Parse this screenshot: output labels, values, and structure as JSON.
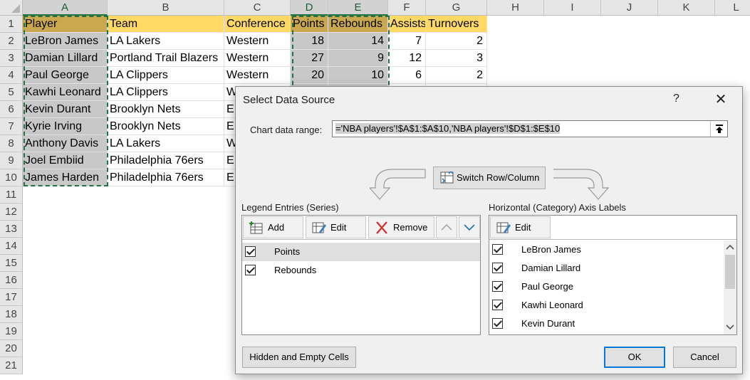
{
  "sheet": {
    "columns": [
      "A",
      "B",
      "C",
      "D",
      "E",
      "F",
      "G",
      "H",
      "I",
      "J",
      "K",
      "L"
    ],
    "rows": [
      "1",
      "2",
      "3",
      "4",
      "5",
      "6",
      "7",
      "8",
      "9",
      "10",
      "11",
      "12",
      "13",
      "14",
      "15",
      "16",
      "17",
      "18",
      "19",
      "20",
      "21"
    ],
    "header": [
      "Player",
      "Team",
      "Conference",
      "Points",
      "Rebounds",
      "Assists",
      "Turnovers"
    ],
    "data": [
      [
        "LeBron James",
        "LA Lakers",
        "Western",
        "18",
        "14",
        "7",
        "2"
      ],
      [
        "Damian Lillard",
        "Portland Trail Blazers",
        "Western",
        "27",
        "9",
        "12",
        "3"
      ],
      [
        "Paul George",
        "LA Clippers",
        "Western",
        "20",
        "10",
        "6",
        "2"
      ],
      [
        "Kawhi Leonard",
        "LA Clippers",
        "W",
        "",
        "",
        "",
        ""
      ],
      [
        "Kevin Durant",
        "Brooklyn Nets",
        "E",
        "",
        "",
        "",
        ""
      ],
      [
        "Kyrie Irving",
        "Brooklyn Nets",
        "E",
        "",
        "",
        "",
        ""
      ],
      [
        "Anthony Davis",
        "LA Lakers",
        "W",
        "",
        "",
        "",
        ""
      ],
      [
        "Joel Embiid",
        "Philadelphia 76ers",
        "E",
        "",
        "",
        "",
        ""
      ],
      [
        "James Harden",
        "Philadelphia 76ers",
        "E",
        "",
        "",
        "",
        ""
      ]
    ],
    "colors": {
      "header_fill": "#ffd966",
      "selection_fill": "#c8c8c8",
      "marquee": "#217346"
    }
  },
  "dialog": {
    "title": "Select Data Source",
    "help": "?",
    "close": "✕",
    "range_label": "Chart data range:",
    "range_value": "='NBA players'!$A$1:$A$10,'NBA players'!$D$1:$E$10",
    "switch_label": "Switch Row/Column",
    "legend_label": "Legend Entries (Series)",
    "axis_label": "Horizontal (Category) Axis Labels",
    "legend_toolbar": {
      "add": "Add",
      "edit": "Edit",
      "remove": "Remove"
    },
    "axis_toolbar": {
      "edit": "Edit"
    },
    "series": [
      "Points",
      "Rebounds"
    ],
    "categories": [
      "LeBron James",
      "Damian Lillard",
      "Paul George",
      "Kawhi Leonard",
      "Kevin Durant"
    ],
    "hidden_cells": "Hidden and Empty Cells",
    "ok": "OK",
    "cancel": "Cancel"
  }
}
